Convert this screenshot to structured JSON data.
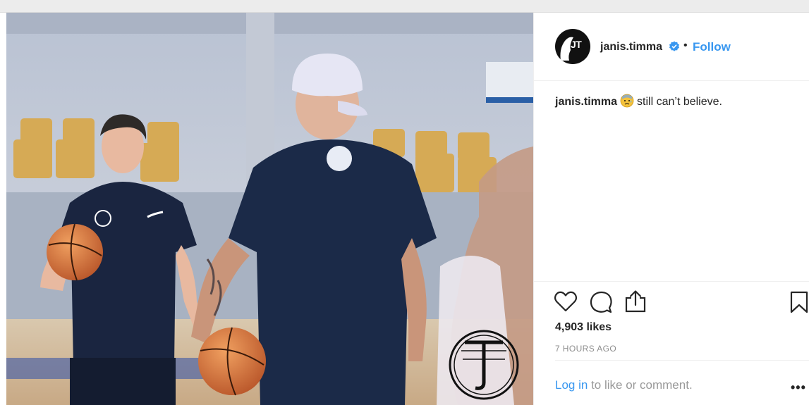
{
  "post": {
    "username": "janis.timma",
    "follow_label": "Follow",
    "separator": "•",
    "avatar_initials": "JT",
    "caption": {
      "username": "janis.timma",
      "text": "still can’t believe."
    },
    "likes": "4,903 likes",
    "time": "7 HOURS AGO",
    "login": {
      "link": "Log in",
      "rest": "to like or comment."
    },
    "more_label": "•••"
  },
  "colors": {
    "link": "#3897f0",
    "text": "#262626",
    "muted": "#8e8e8e"
  },
  "icons": [
    "heart-icon",
    "comment-icon",
    "share-icon",
    "bookmark-icon",
    "verified-badge-icon",
    "sweat-emoji-icon"
  ]
}
